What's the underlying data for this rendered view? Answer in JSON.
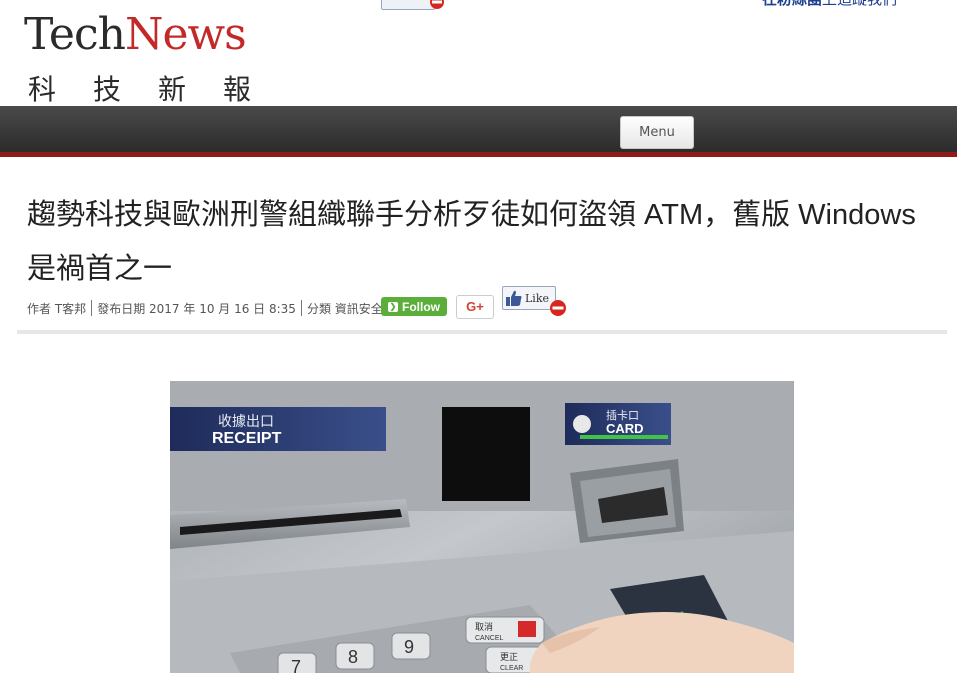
{
  "header": {
    "top_link_bold": "在粉絲團",
    "top_link_rest": "上追蹤我們",
    "logo_tech": "Tech",
    "logo_news": "News",
    "logo_subtitle": "科技新報",
    "menu_label": "Menu"
  },
  "article": {
    "title": "趨勢科技與歐洲刑警組織聯手分析歹徒如何盜領 ATM，舊版 Windows 是禍首之一",
    "meta": {
      "author_label": "作者",
      "author": "T客邦",
      "published_label": "發布日期",
      "published": "2017 年 10 月 16 日 8:35",
      "category_label": "分類",
      "category": "資訊安全"
    },
    "buttons": {
      "follow": "Follow",
      "gplus": "G+",
      "like": "Like"
    }
  },
  "image": {
    "receipt_cn": "收據出口",
    "receipt_en": "RECEIPT",
    "card_cn": "插卡口",
    "card_en": "CARD",
    "cancel_cn": "取消",
    "cancel_en": "CANCEL",
    "clear_cn": "更正",
    "clear_en": "CLEAR",
    "keys": [
      "7",
      "8",
      "9"
    ]
  },
  "colors": {
    "brand_red": "#c4292a",
    "nav_rule": "#8e1b17",
    "follow_green": "#5cae3a",
    "gplus_red": "#d44133",
    "link_blue": "#1d3f8f"
  }
}
